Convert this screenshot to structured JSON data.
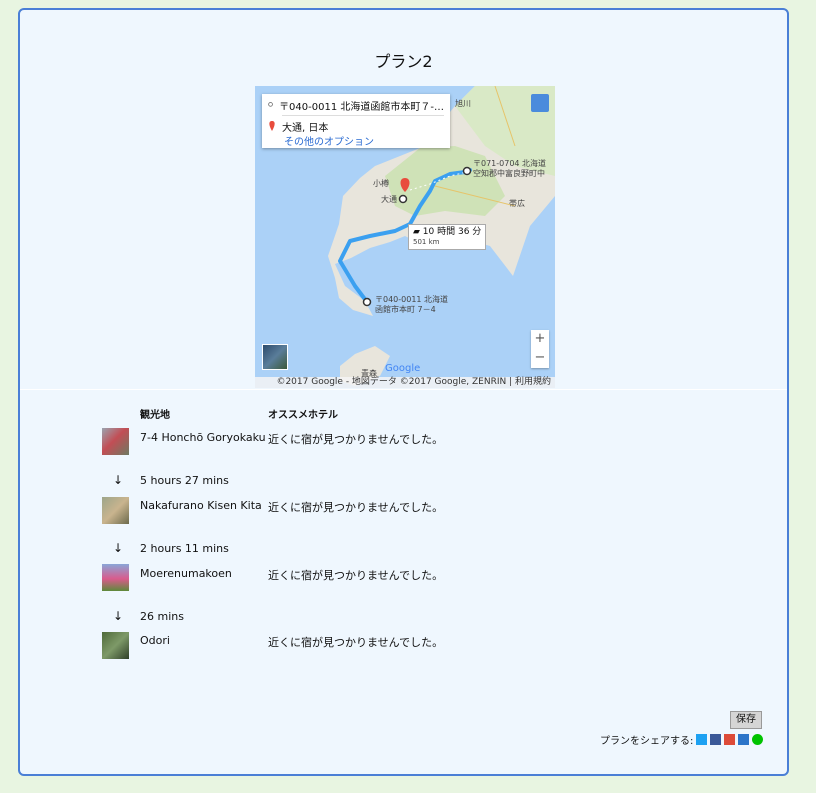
{
  "plan": {
    "title": "プラン2"
  },
  "map": {
    "origin": "〒040-0011 北海道函館市本町７-…",
    "destination": "大通, 日本",
    "more_options": "その他のオプション",
    "duration": "10 時間 36 分",
    "distance": "501 km",
    "labels": {
      "asahikawa": "旭川",
      "otaru": "小樽",
      "odori": "大通",
      "obihiro": "帯広",
      "end1": "〒071-0704 北海道",
      "end2": "空知郡中富良野町中",
      "start1": "〒040-0011 北海道",
      "start2": "函館市本町 7－4",
      "aomori": "青森"
    },
    "zoom_in": "+",
    "zoom_out": "−",
    "google": "Google",
    "footer": "©2017 Google - 地図データ ©2017 Google, ZENRIN | 利用規約"
  },
  "table": {
    "col_spot": "観光地",
    "col_hotel": "オススメホテル",
    "rows": [
      {
        "name": "7-4 Honchō Goryokaku",
        "hotel": "近くに宿が見つかりませんでした。"
      },
      {
        "name": "Nakafurano Kisen Kita",
        "hotel": "近くに宿が見つかりませんでした。"
      },
      {
        "name": "Moerenumakoen",
        "hotel": "近くに宿が見つかりませんでした。"
      },
      {
        "name": "Odori",
        "hotel": "近くに宿が見つかりませんでした。"
      }
    ],
    "legs": [
      {
        "arrow": "↓",
        "time": "5 hours 27 mins"
      },
      {
        "arrow": "↓",
        "time": "2 hours 11 mins"
      },
      {
        "arrow": "↓",
        "time": "26 mins"
      }
    ]
  },
  "actions": {
    "save": "保存",
    "share_label": "プランをシェアする:"
  },
  "colors": {
    "accent": "#4a7fd6",
    "route": "#3ba0f0"
  }
}
